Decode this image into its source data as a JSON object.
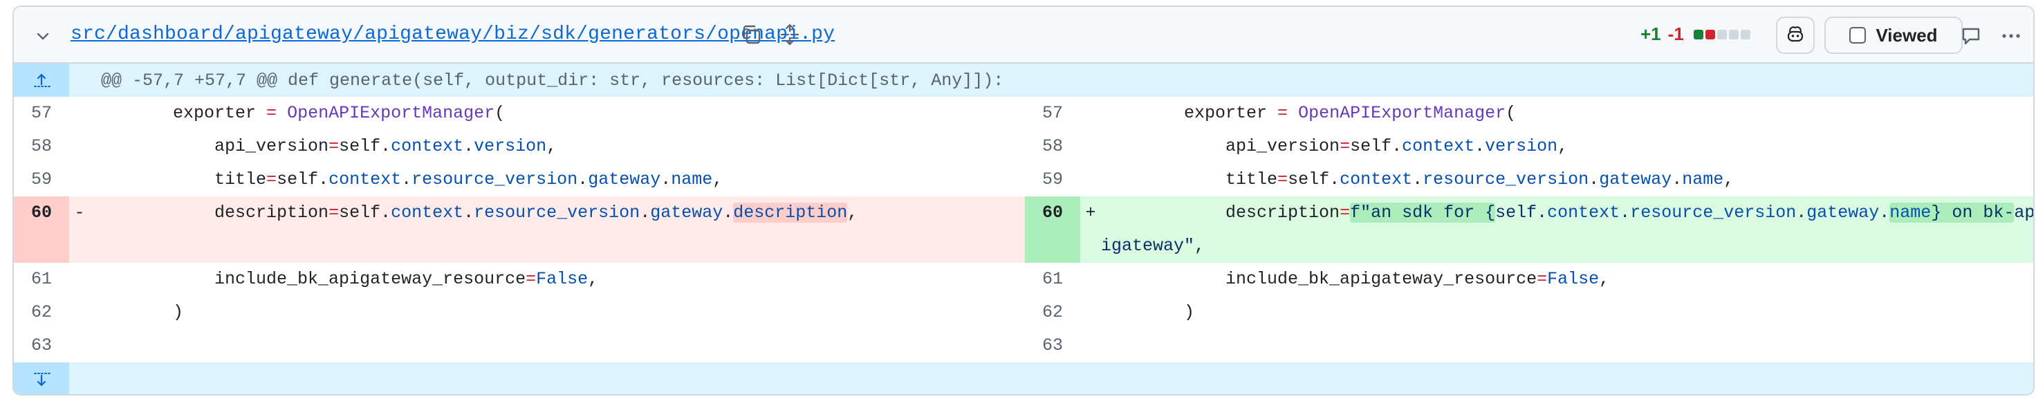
{
  "file": {
    "path": "src/dashboard/apigateway/apigateway/biz/sdk/generators/openapi.py",
    "additions": "+1",
    "deletions": "-1",
    "viewed_label": "Viewed",
    "stat_colors": {
      "add": "#1a7f37",
      "del": "#d1242f",
      "neutral": "#d1d9e0"
    }
  },
  "icons": [
    "chevron-down-icon",
    "copy-icon",
    "expand-icon",
    "copilot-icon",
    "comment-icon",
    "kebab-icon",
    "expand-up-icon",
    "expand-down-icon"
  ],
  "hunk": {
    "header": "@@ -57,7 +57,7 @@ def generate(self, output_dir: str, resources: List[Dict[str, Any]]):"
  },
  "left": {
    "lines": [
      {
        "num": "57",
        "sign": "",
        "code": "        exporter = OpenAPIExportManager("
      },
      {
        "num": "58",
        "sign": "",
        "code": "            api_version=self.context.version,"
      },
      {
        "num": "59",
        "sign": "",
        "code": "            title=self.context.resource_version.gateway.name,"
      },
      {
        "num": "60",
        "sign": "-",
        "code": "            description=self.context.resource_version.gateway.description,"
      },
      {
        "num": "61",
        "sign": "",
        "code": "            include_bk_apigateway_resource=False,"
      },
      {
        "num": "62",
        "sign": "",
        "code": "        )"
      },
      {
        "num": "63",
        "sign": "",
        "code": ""
      }
    ]
  },
  "right": {
    "lines": [
      {
        "num": "57",
        "sign": "",
        "code": "        exporter = OpenAPIExportManager("
      },
      {
        "num": "58",
        "sign": "",
        "code": "            api_version=self.context.version,"
      },
      {
        "num": "59",
        "sign": "",
        "code": "            title=self.context.resource_version.gateway.name,"
      },
      {
        "num": "60",
        "sign": "+",
        "code": "            description=f\"an sdk for {self.context.resource_version.gateway.name} on bk-apigateway\","
      },
      {
        "num": "61",
        "sign": "",
        "code": "            include_bk_apigateway_resource=False,"
      },
      {
        "num": "62",
        "sign": "",
        "code": "        )"
      },
      {
        "num": "63",
        "sign": "",
        "code": ""
      }
    ]
  }
}
